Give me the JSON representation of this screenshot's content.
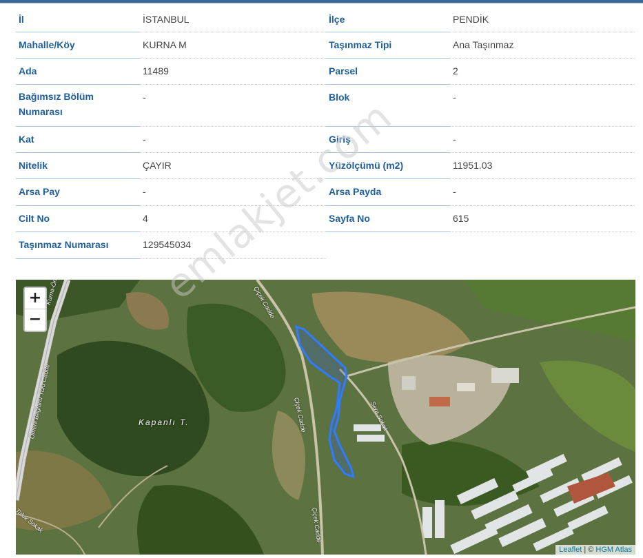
{
  "rows": [
    [
      {
        "l": "İl",
        "v": "İSTANBUL"
      },
      {
        "l": "İlçe",
        "v": "PENDİK"
      }
    ],
    [
      {
        "l": "Mahalle/Köy",
        "v": "KURNA M"
      },
      {
        "l": "Taşınmaz Tipi",
        "v": "Ana Taşınmaz"
      }
    ],
    [
      {
        "l": "Ada",
        "v": "11489"
      },
      {
        "l": "Parsel",
        "v": "2"
      }
    ],
    [
      {
        "l": "Bağımsız Bölüm Numarası",
        "v": "-"
      },
      {
        "l": "Blok",
        "v": "-"
      }
    ],
    [
      {
        "l": "Kat",
        "v": "-"
      },
      {
        "l": "Giriş",
        "v": "-"
      }
    ],
    [
      {
        "l": "Nitelik",
        "v": "ÇAYIR"
      },
      {
        "l": "Yüzölçümü (m2)",
        "v": "11951.03"
      }
    ],
    [
      {
        "l": "Arsa Pay",
        "v": "-"
      },
      {
        "l": "Arsa Payda",
        "v": "-"
      }
    ],
    [
      {
        "l": "Cilt No",
        "v": "4"
      },
      {
        "l": "Sayfa No",
        "v": "615"
      }
    ],
    [
      {
        "l": "Taşınmaz Numarası",
        "v": "129545034"
      }
    ]
  ],
  "map": {
    "zoom_in": "+",
    "zoom_out": "−",
    "attribution_leaflet": "Leaflet",
    "attribution_sep": " | © ",
    "attribution_atlas": "HGM Atlas",
    "labels": {
      "hill": "Kapanlı T.",
      "road1": "Kurna-Ömerli",
      "road2": "Ömerli Bağlantı Yolu Cadde",
      "road3": "Çiçek Cadde",
      "road4": "Çiçek Cadde",
      "road5": "Çiçek Cadde",
      "road6": "Sera Sokak",
      "road7": "Tuluk Sokak"
    }
  },
  "watermark": "emlakjet.com",
  "colors": {
    "label": "#1f5f9b",
    "parcel_outline": "#2e7cff"
  }
}
